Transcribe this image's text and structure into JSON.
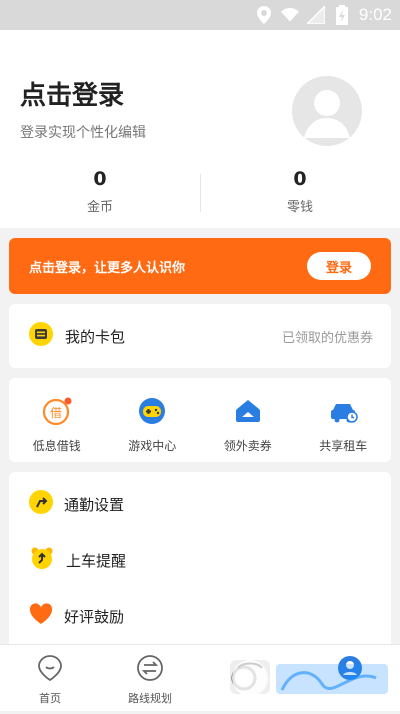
{
  "status_bar": {
    "time": "9:02"
  },
  "profile": {
    "title": "点击登录",
    "subtitle": "登录实现个性化编辑",
    "coins": {
      "value": "0",
      "label": "金币"
    },
    "wallet_cash": {
      "value": "0",
      "label": "零钱"
    }
  },
  "banner": {
    "text": "点击登录，让更多人认识你",
    "button": "登录"
  },
  "wallet": {
    "label": "我的卡包",
    "right_text": "已领取的优惠券"
  },
  "services": [
    {
      "label": "低息借钱",
      "icon": "loan-icon"
    },
    {
      "label": "游戏中心",
      "icon": "game-icon"
    },
    {
      "label": "领外卖券",
      "icon": "coupon-icon"
    },
    {
      "label": "共享租车",
      "icon": "car-icon"
    }
  ],
  "settings": [
    {
      "label": "通勤设置",
      "icon": "commute-icon"
    },
    {
      "label": "上车提醒",
      "icon": "alarm-icon"
    },
    {
      "label": "好评鼓励",
      "icon": "heart-icon"
    }
  ],
  "bottom_nav": [
    {
      "label": "首页",
      "icon": "home-icon"
    },
    {
      "label": "路线规划",
      "icon": "route-icon"
    }
  ],
  "colors": {
    "accent": "#ff6a13",
    "icon_yellow": "#ffd400",
    "heart": "#ff6a13",
    "blue": "#2a7de1"
  }
}
